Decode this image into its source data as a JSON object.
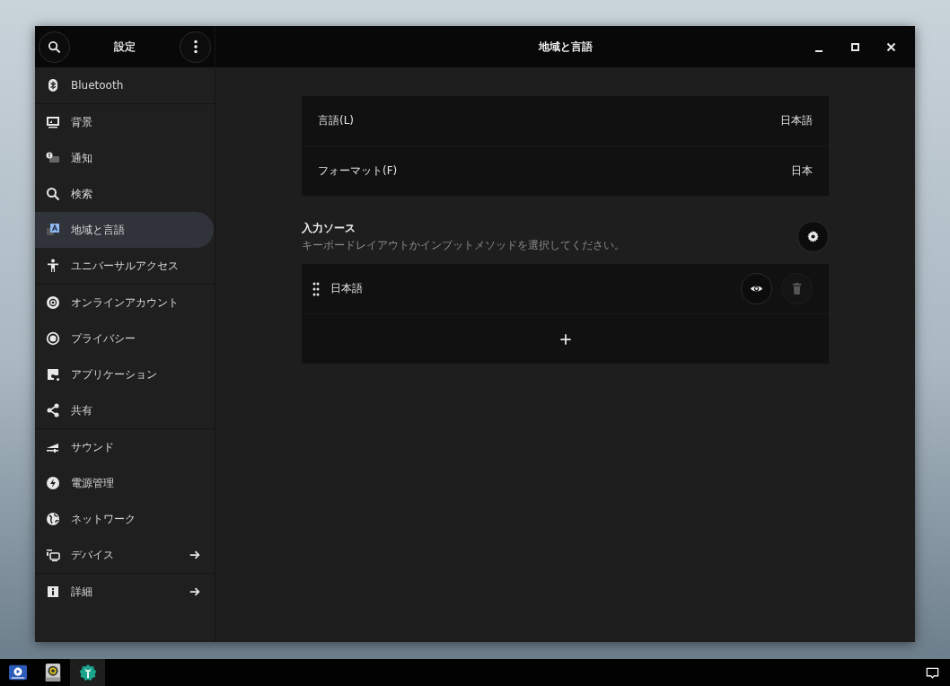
{
  "window": {
    "title": "地域と言語",
    "sidebar_title": "設定"
  },
  "sidebar": {
    "groups": [
      [
        {
          "label": "Bluetooth",
          "selected": false
        }
      ],
      [
        {
          "label": "背景",
          "selected": false
        },
        {
          "label": "通知",
          "selected": false
        },
        {
          "label": "検索",
          "selected": false
        },
        {
          "label": "地域と言語",
          "selected": true
        },
        {
          "label": "ユニバーサルアクセス",
          "selected": false
        }
      ],
      [
        {
          "label": "オンラインアカウント",
          "selected": false
        },
        {
          "label": "プライバシー",
          "selected": false
        },
        {
          "label": "アプリケーション",
          "selected": false
        },
        {
          "label": "共有",
          "selected": false
        }
      ],
      [
        {
          "label": "サウンド",
          "selected": false
        },
        {
          "label": "電源管理",
          "selected": false
        },
        {
          "label": "ネットワーク",
          "selected": false
        },
        {
          "label": "デバイス",
          "selected": false,
          "submenu": true
        }
      ],
      [
        {
          "label": "詳細",
          "selected": false,
          "submenu": true
        }
      ]
    ]
  },
  "settings": [
    {
      "label": "言語(L)",
      "value": "日本語"
    },
    {
      "label": "フォーマット(F)",
      "value": "日本"
    }
  ],
  "input_sources": {
    "title": "入力ソース",
    "description": "キーボードレイアウトかインプットメソッドを選択してください。",
    "items": [
      {
        "label": "日本語",
        "remove_disabled": true
      }
    ]
  }
}
